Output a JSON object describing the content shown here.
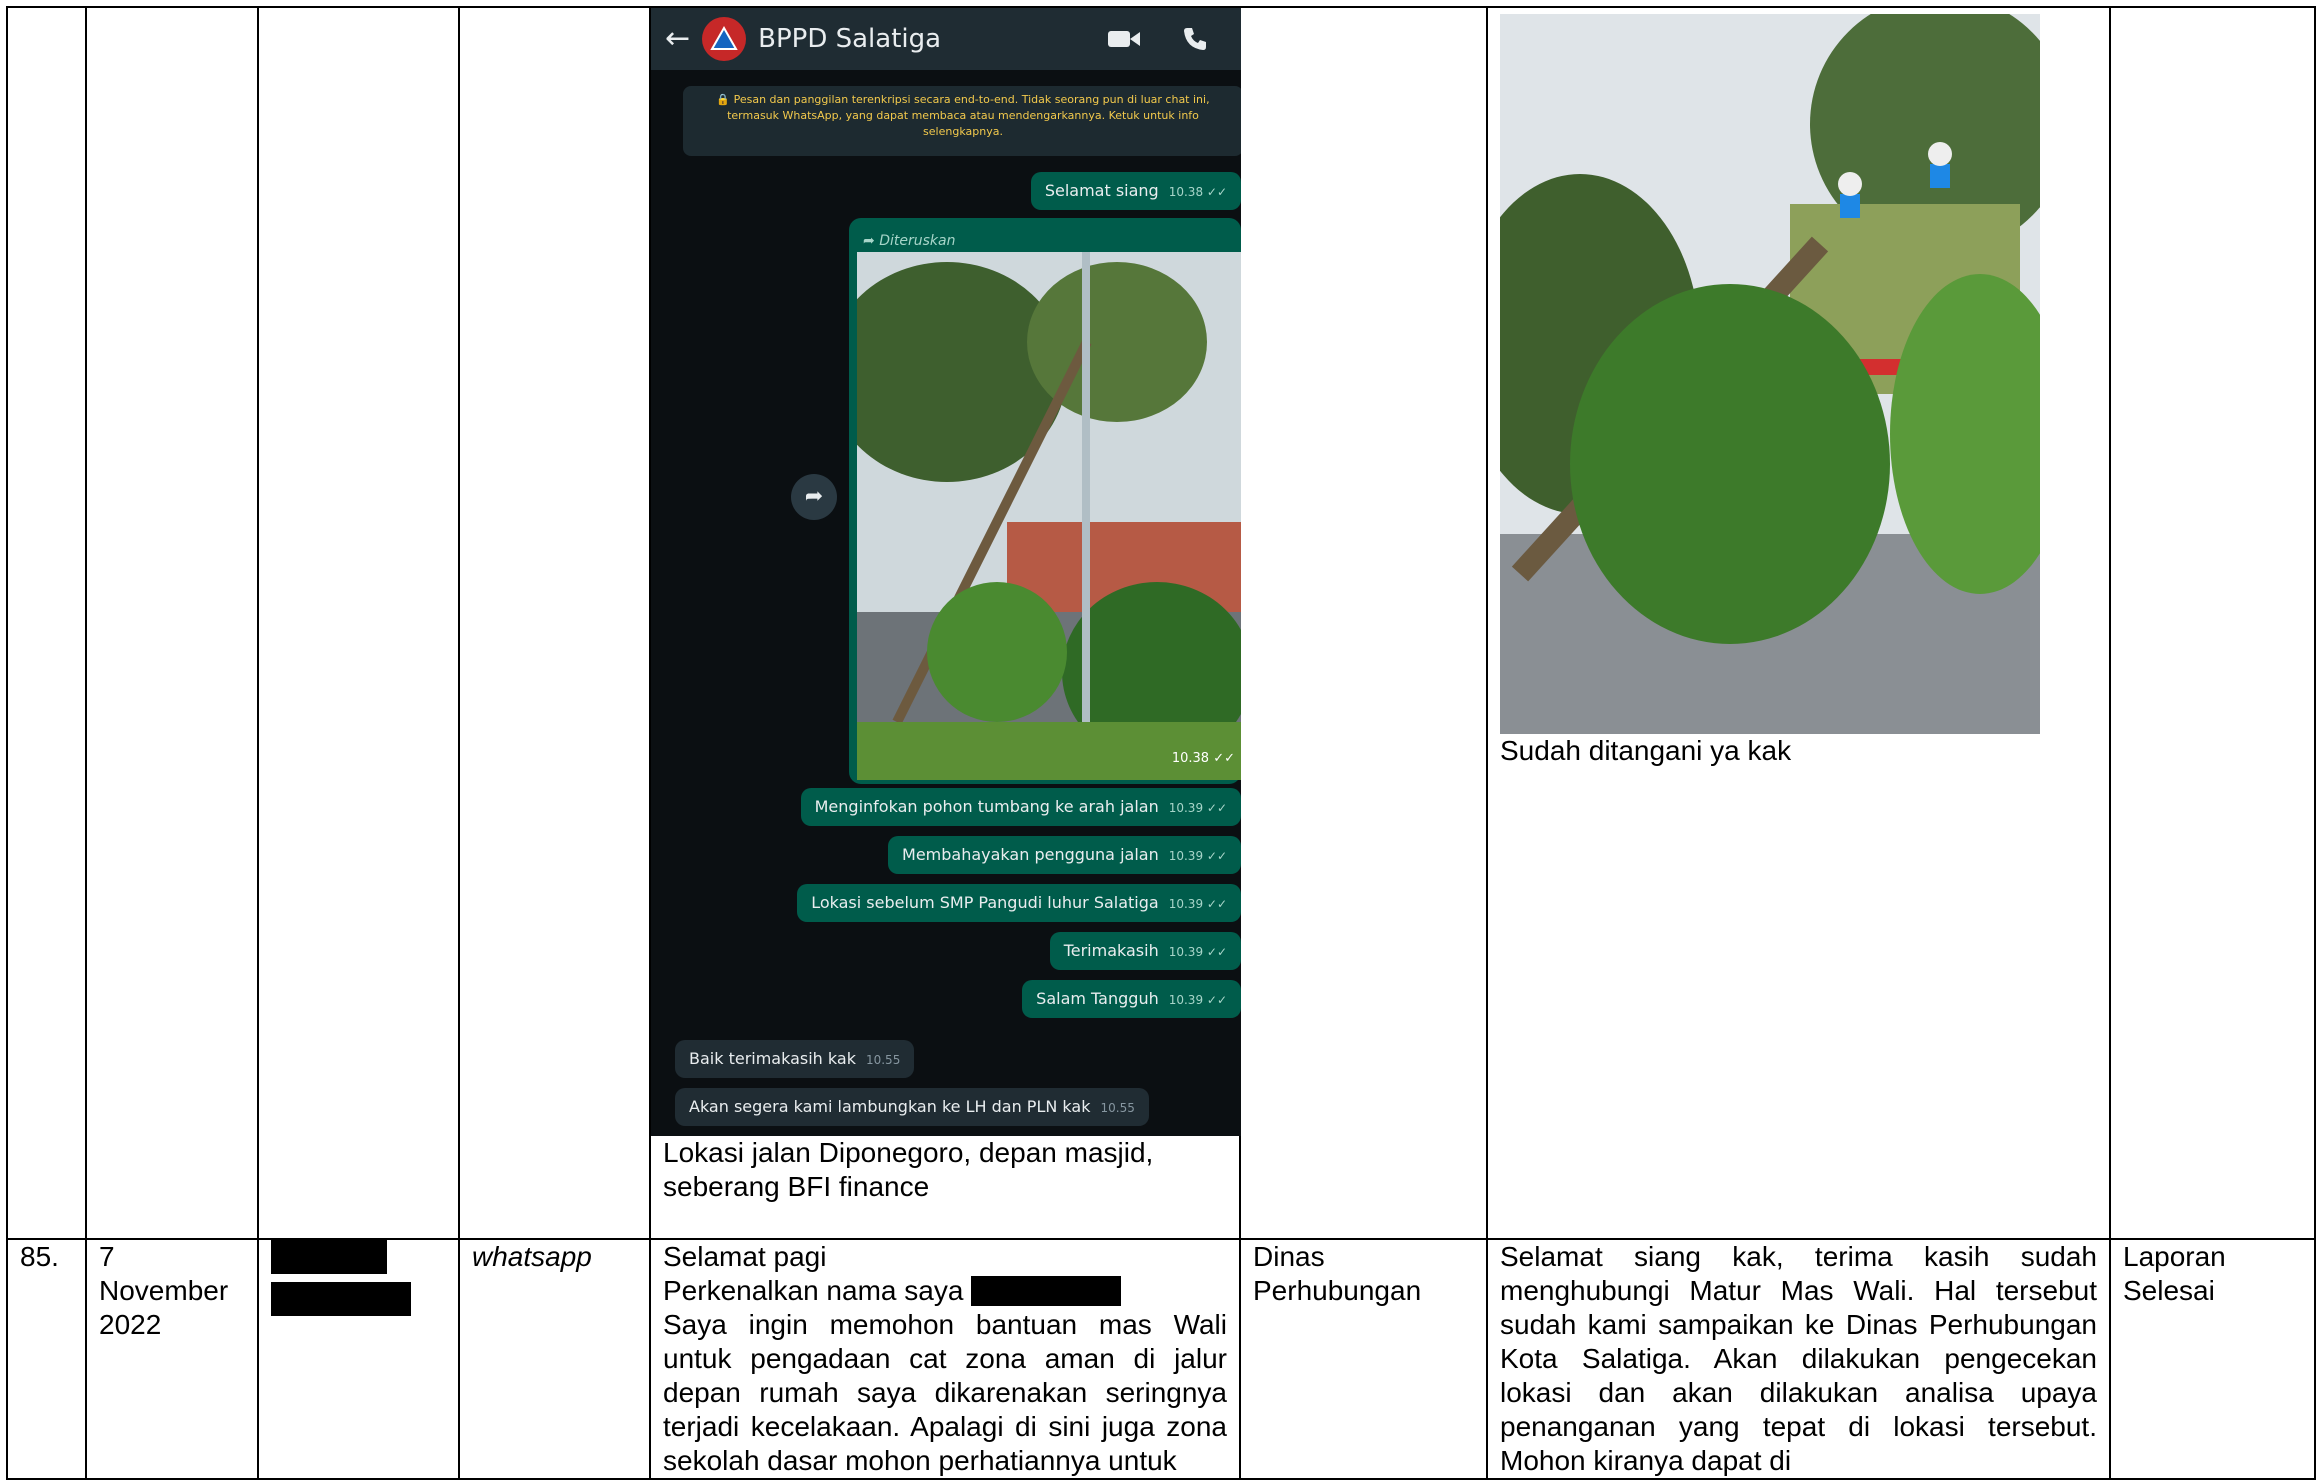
{
  "row_top": {
    "whatsapp_screen": {
      "contact_name": "BPPD Salatiga",
      "encryption_notice": "🔒 Pesan dan panggilan terenkripsi secara end-to-end. Tidak seorang pun di luar chat ini, termasuk WhatsApp, yang dapat membaca atau mendengarkannya. Ketuk untuk info selengkapnya.",
      "messages_out": [
        {
          "text": "Selamat siang",
          "time": "10.38 ✓✓"
        },
        {
          "text": "Menginfokan pohon tumbang ke arah jalan",
          "time": "10.39 ✓✓"
        },
        {
          "text": "Membahayakan pengguna jalan",
          "time": "10.39 ✓✓"
        },
        {
          "text": "Lokasi sebelum SMP Pangudi luhur Salatiga",
          "time": "10.39 ✓✓"
        },
        {
          "text": "Terimakasih",
          "time": "10.39 ✓✓"
        },
        {
          "text": "Salam Tangguh",
          "time": "10.39 ✓✓"
        }
      ],
      "forwarded_label": "Diteruskan",
      "forwarded_time": "10.38 ✓✓",
      "messages_in": [
        {
          "text": "Baik terimakasih kak",
          "time": "10.55"
        },
        {
          "text": "Akan segera kami lambungkan ke LH dan PLN kak",
          "time": "10.55"
        }
      ]
    },
    "report_caption": "Lokasi jalan Diponegoro, depan masjid, seberang BFI finance",
    "response_caption": "Sudah ditangani ya kak"
  },
  "row_85": {
    "number": "85.",
    "date": "7 November 2022",
    "channel": "whatsapp",
    "report_line1": "Selamat pagi",
    "report_line2": "Perkenalkan nama saya",
    "report_body": "Saya ingin memohon bantuan mas Wali untuk pengadaan cat zona aman di jalur depan rumah saya dikarenakan seringnya terjadi kecelakaan. Apalagi di sini juga zona sekolah dasar mohon perhatiannya untuk",
    "agency": "Dinas Perhubungan",
    "response": "Selamat siang kak, terima kasih sudah menghubungi Matur Mas Wali. Hal tersebut sudah kami sampaikan ke Dinas Perhubungan Kota Salatiga. Akan dilakukan pengecekan lokasi dan akan dilakukan analisa upaya penanganan yang tepat di lokasi tersebut. Mohon kiranya dapat di",
    "status": "Laporan Selesai"
  }
}
